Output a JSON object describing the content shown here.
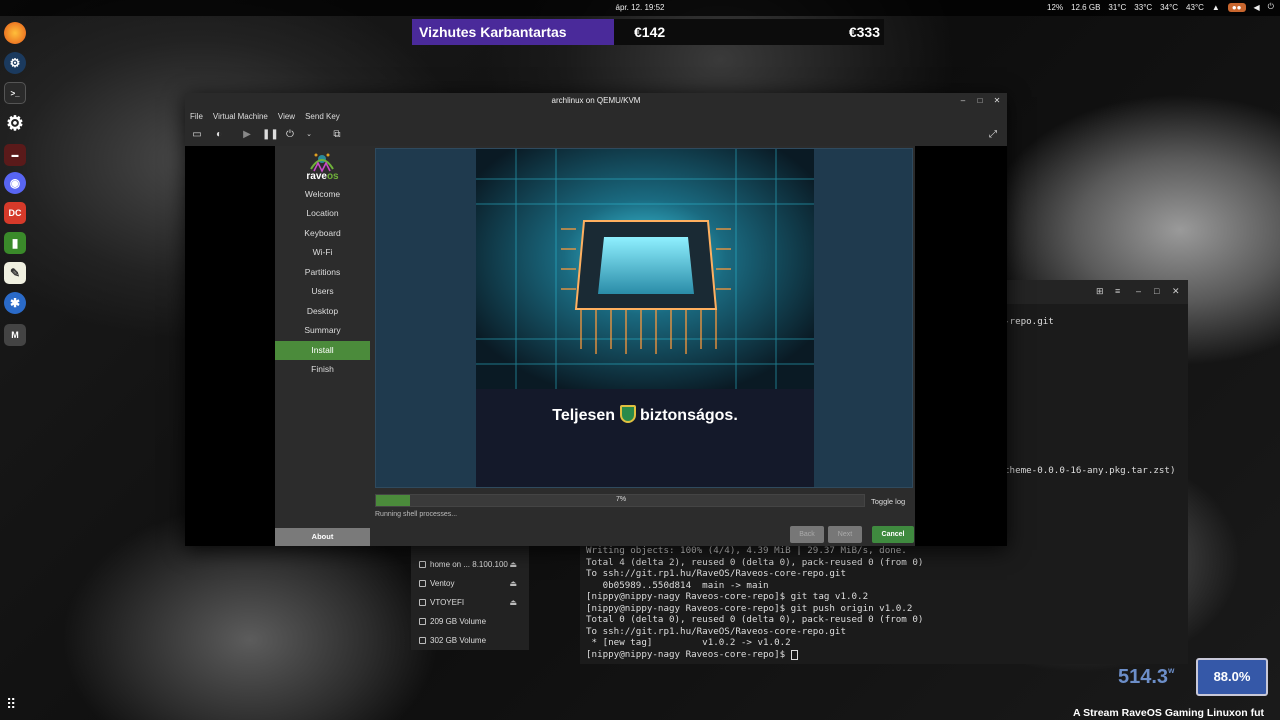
{
  "topbar": {
    "clock": "ápr. 12. 19:52",
    "tray": [
      "12%",
      "12.6 GB",
      "31°C",
      "33°C",
      "34°C",
      "43°C"
    ]
  },
  "overlay": {
    "title": "Vizhutes Karbantartas",
    "price1": "€142",
    "price2": "€333"
  },
  "dock": {
    "icons": [
      "firefox-icon",
      "steam-icon",
      "terminal-icon",
      "settings-icon",
      "game-icon",
      "discord-icon",
      "app-icon",
      "notes-icon",
      "editor-icon",
      "bug-icon",
      "raveos-icon"
    ]
  },
  "vm": {
    "title": "archlinux on QEMU/KVM",
    "menu": [
      "File",
      "Virtual Machine",
      "View",
      "Send Key"
    ]
  },
  "installer": {
    "logo_prefix": "rave",
    "logo_suffix": "os",
    "steps": [
      "Welcome",
      "Location",
      "Keyboard",
      "Wi-Fi",
      "Partitions",
      "Users",
      "Desktop",
      "Summary",
      "Install",
      "Finish"
    ],
    "active_step": "Install",
    "about": "About",
    "slide_caption_before": "Teljesen",
    "slide_caption_after": "biztonságos.",
    "progress_label": "7%",
    "progress": 0.07,
    "toggle_log": "Toggle log",
    "status": "Running shell processes...",
    "back": "Back",
    "next": "Next",
    "cancel": "Cancel"
  },
  "terminal": {
    "side_lines": [
      "-repo.git",
      "cheme-0.0.0-16-any.pkg.tar.zst)"
    ],
    "lines": [
      "Writing objects: 100% (4/4), 4.39 MiB | 29.37 MiB/s, done.",
      "Total 4 (delta 2), reused 0 (delta 0), pack-reused 0 (from 0)",
      "To ssh://git.rp1.hu/RaveOS/Raveos-core-repo.git",
      "   0b05989..550d814  main -> main",
      "[nippy@nippy-nagy Raveos-core-repo]$ git tag v1.0.2",
      "[nippy@nippy-nagy Raveos-core-repo]$ git push origin v1.0.2",
      "Total 0 (delta 0), reused 0 (delta 0), pack-reused 0 (from 0)",
      "To ssh://git.rp1.hu/RaveOS/Raveos-core-repo.git",
      " * [new tag]         v1.0.2 -> v1.0.2",
      "[nippy@nippy-nagy Raveos-core-repo]$ "
    ]
  },
  "files": {
    "items": [
      {
        "label": "home on ... 8.100.100",
        "eject": true
      },
      {
        "label": "Ventoy",
        "eject": true
      },
      {
        "label": "VTOYEFI",
        "eject": true
      },
      {
        "label": "209 GB Volume",
        "eject": false
      },
      {
        "label": "302 GB Volume",
        "eject": false
      }
    ]
  },
  "stream": {
    "watts": "514.3",
    "watts_unit": "w",
    "percent": "88.0%",
    "ticker": "A Stream RaveOS Gaming Linuxon fut"
  }
}
